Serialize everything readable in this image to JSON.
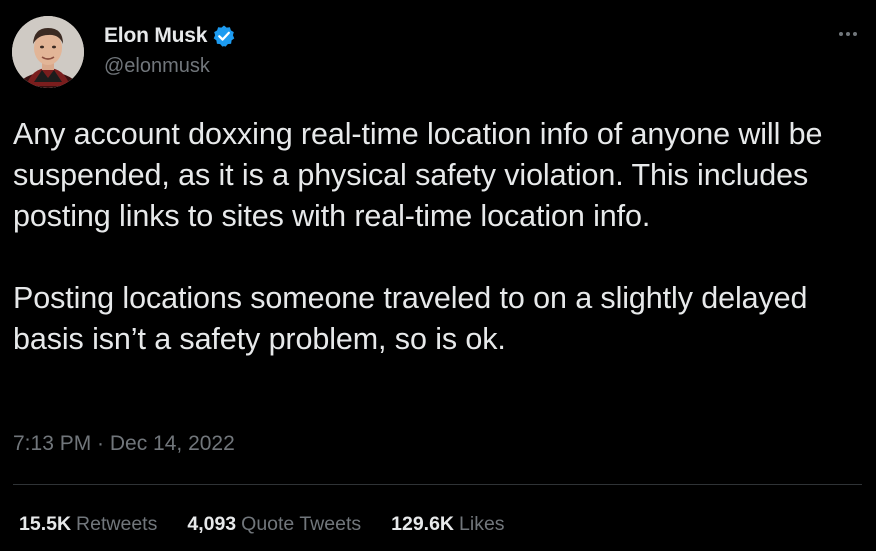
{
  "author": {
    "display_name": "Elon Musk",
    "handle": "@elonmusk",
    "verified": true,
    "verified_color": "#1d9bf0"
  },
  "menu": {
    "icon": "more-horizontal-icon"
  },
  "tweet": {
    "paragraphs": [
      "Any account doxxing real-time location info of anyone will be suspended, as it is a physical safety violation. This includes posting links to sites with real-time location info.",
      "Posting locations someone traveled to on a slightly delayed basis isn’t a safety problem, so is ok."
    ],
    "timestamp": "7:13 PM · Dec 14, 2022"
  },
  "stats": {
    "retweets": {
      "value": "15.5K",
      "label": "Retweets"
    },
    "quote_tweets": {
      "value": "4,093",
      "label": "Quote Tweets"
    },
    "likes": {
      "value": "129.6K",
      "label": "Likes"
    }
  },
  "colors": {
    "background": "#000000",
    "text_primary": "#e7e9ea",
    "text_secondary": "#71767b",
    "divider": "#2f3336"
  }
}
